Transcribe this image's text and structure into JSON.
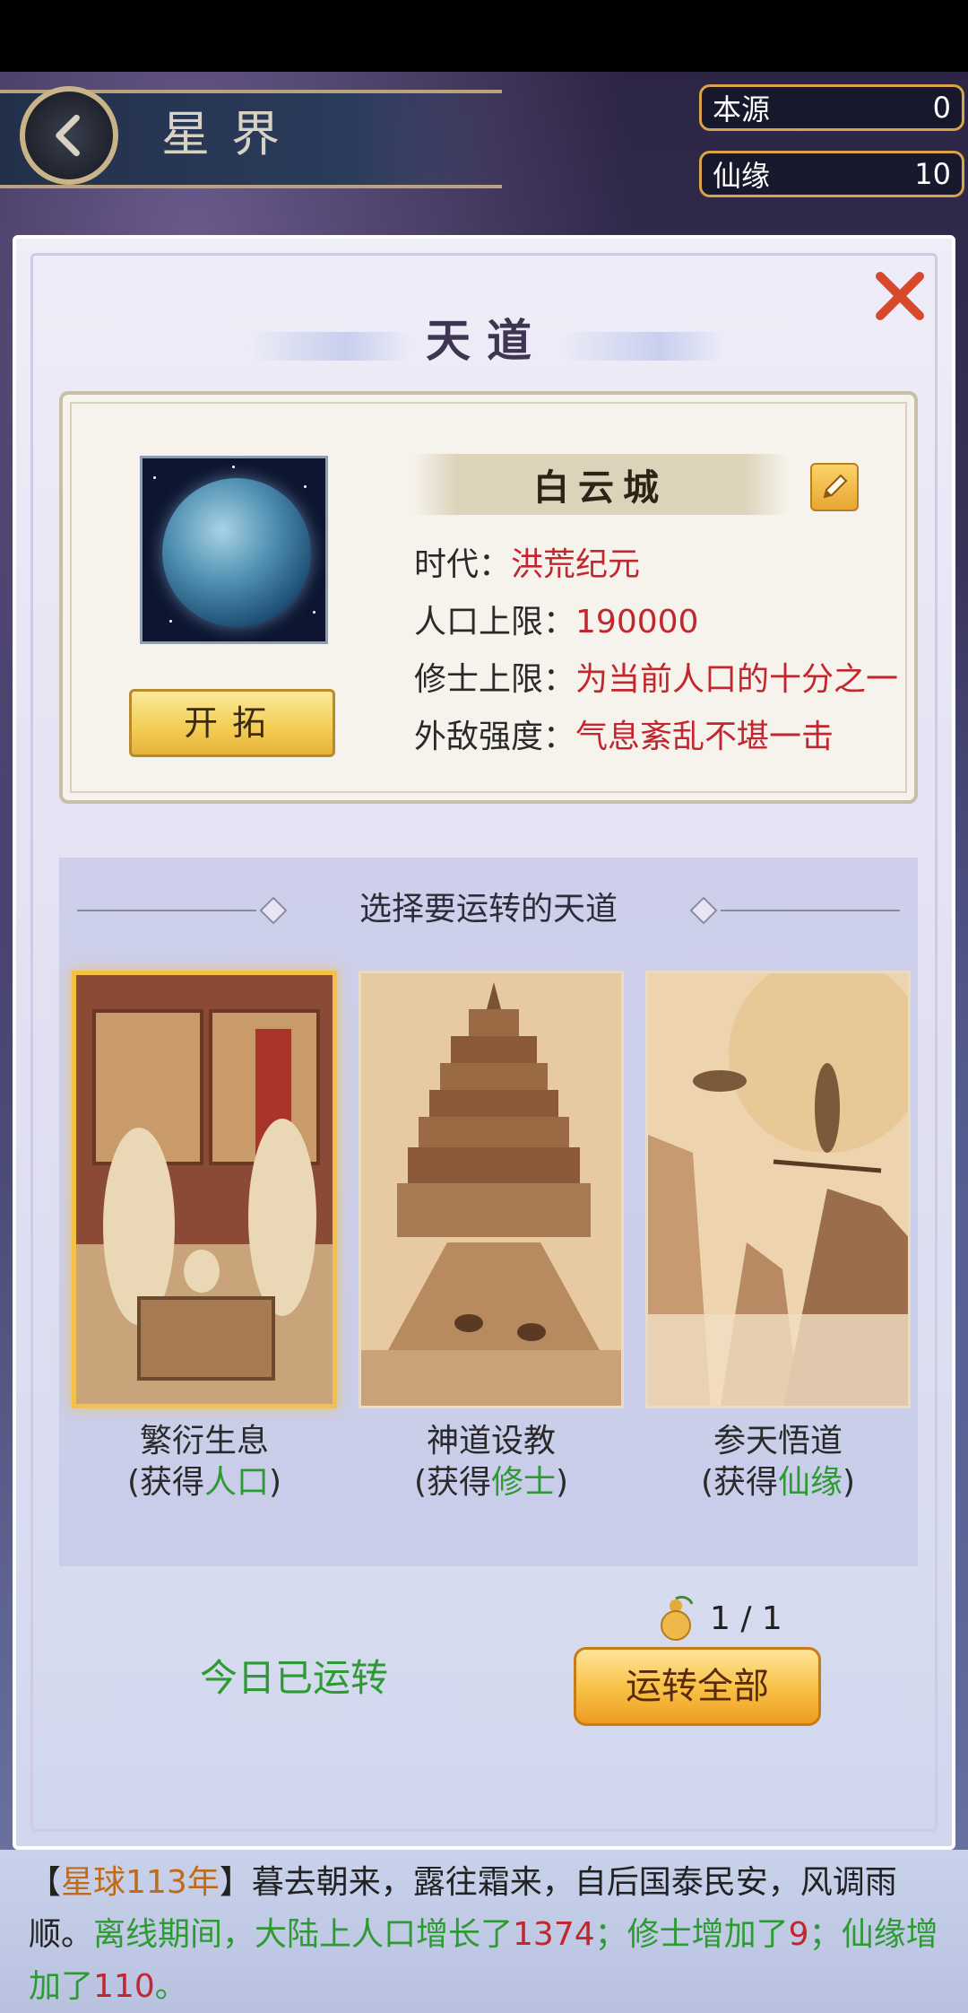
{
  "header": {
    "title": "星界",
    "resources": [
      {
        "label": "本源",
        "value": "0"
      },
      {
        "label": "仙缘",
        "value": "10"
      }
    ]
  },
  "modal": {
    "title": "天道",
    "planet": {
      "name": "白云城",
      "expand_label": "开拓",
      "stats": [
        {
          "key": "时代：",
          "value": "洪荒纪元"
        },
        {
          "key": "人口上限：",
          "value": "190000"
        },
        {
          "key": "修士上限：",
          "value": "为当前人口的十分之一"
        },
        {
          "key": "外敌强度：",
          "value": "气息紊乱不堪一击"
        }
      ]
    },
    "select_title": "选择要运转的天道",
    "paths": [
      {
        "name": "繁衍生息",
        "gain_prefix": "(获得",
        "gain": "人口",
        "gain_suffix": ")",
        "selected": true
      },
      {
        "name": "神道设教",
        "gain_prefix": "(获得",
        "gain": "修士",
        "gain_suffix": ")",
        "selected": false
      },
      {
        "name": "参天悟道",
        "gain_prefix": "(获得",
        "gain": "仙缘",
        "gain_suffix": ")",
        "selected": false
      }
    ],
    "count_text": "1 / 1",
    "today_status": "今日已运转",
    "run_all_label": "运转全部"
  },
  "log": {
    "open": "【",
    "year": "星球113年",
    "close": "】",
    "text1": "暮去朝来，露往霜来，自后国泰民安，风调雨顺。",
    "text2": "离线期间，大陆上人口增长了",
    "pop": "1374",
    "text3": "；修士增加了",
    "cult": "9",
    "text4": "；仙缘增加了",
    "fate": "110",
    "text5": "。"
  },
  "colors": {
    "accent_gold": "#f3cf57",
    "value_red": "#c2262e",
    "gain_green": "#2d9a34"
  }
}
